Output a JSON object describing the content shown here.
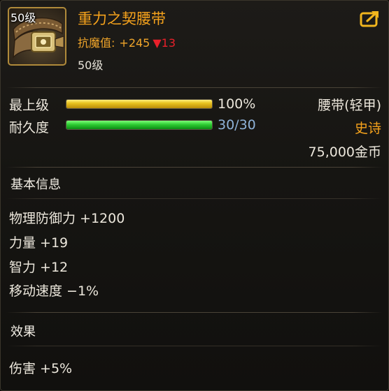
{
  "item": {
    "level_badge": "50级",
    "name": "重力之契腰带",
    "stat_label": "抗魔值:",
    "stat_value": "+245",
    "stat_change": "▼13",
    "required_level": "50级",
    "icon": "belt-icon"
  },
  "bars": {
    "grade_label": "最上级",
    "grade_value": "100%",
    "grade_fill": 1.0,
    "durability_label": "耐久度",
    "durability_value": "30/30",
    "durability_fill": 1.0
  },
  "info": {
    "type": "腰带(轻甲)",
    "rarity": "史诗",
    "price": "75,000金币"
  },
  "basic": {
    "title": "基本信息",
    "lines": [
      "物理防御力 +1200",
      "力量 +19",
      "智力 +12",
      "移动速度 −1%"
    ]
  },
  "effect": {
    "title": "效果",
    "lines": [
      "伤害 +5%"
    ]
  },
  "colors": {
    "name": "#f5a21c",
    "rarity": "#f5a21c",
    "durability_value": "#8fb3d9",
    "stat_down": "#e8202a"
  }
}
